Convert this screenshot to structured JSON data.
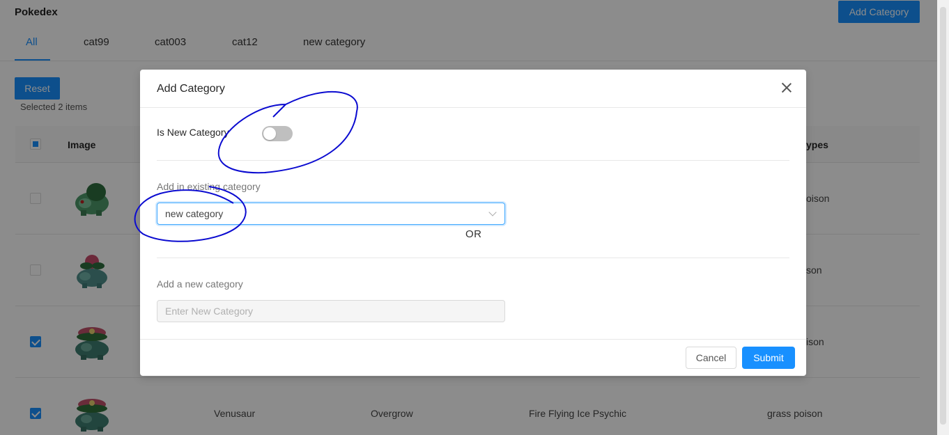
{
  "app": {
    "title": "Pokedex",
    "add_category_label": "Add Category"
  },
  "tabs": [
    {
      "label": "All",
      "active": true
    },
    {
      "label": "cat99"
    },
    {
      "label": "cat003"
    },
    {
      "label": "cat12"
    },
    {
      "label": "new category"
    }
  ],
  "toolbar": {
    "reset_label": "Reset",
    "selected_text": "Selected 2 items"
  },
  "table": {
    "headers": {
      "image": "Image",
      "types_partial": "ypes"
    },
    "rows": [
      {
        "checked": false,
        "sprite": "bulbasaur-sprite",
        "types_partial": "oison"
      },
      {
        "checked": false,
        "sprite": "ivysaur-sprite",
        "types_partial": "son"
      },
      {
        "checked": true,
        "sprite": "venusaur-sprite",
        "types_partial": "ison"
      },
      {
        "checked": true,
        "sprite": "venusaur-sprite",
        "name": "Venusaur",
        "ability": "Overgrow",
        "weakness": "Fire Flying Ice Psychic",
        "types": "grass poison"
      }
    ]
  },
  "modal": {
    "title": "Add Category",
    "is_new_label": "Is New Category",
    "is_new_on": false,
    "existing_label": "Add in existing category",
    "existing_value": "new category",
    "or_text": "OR",
    "new_label": "Add a new category",
    "new_placeholder": "Enter New Category",
    "cancel_label": "Cancel",
    "submit_label": "Submit"
  },
  "colors": {
    "primary": "#1890ff",
    "annotation": "#0000cc"
  }
}
